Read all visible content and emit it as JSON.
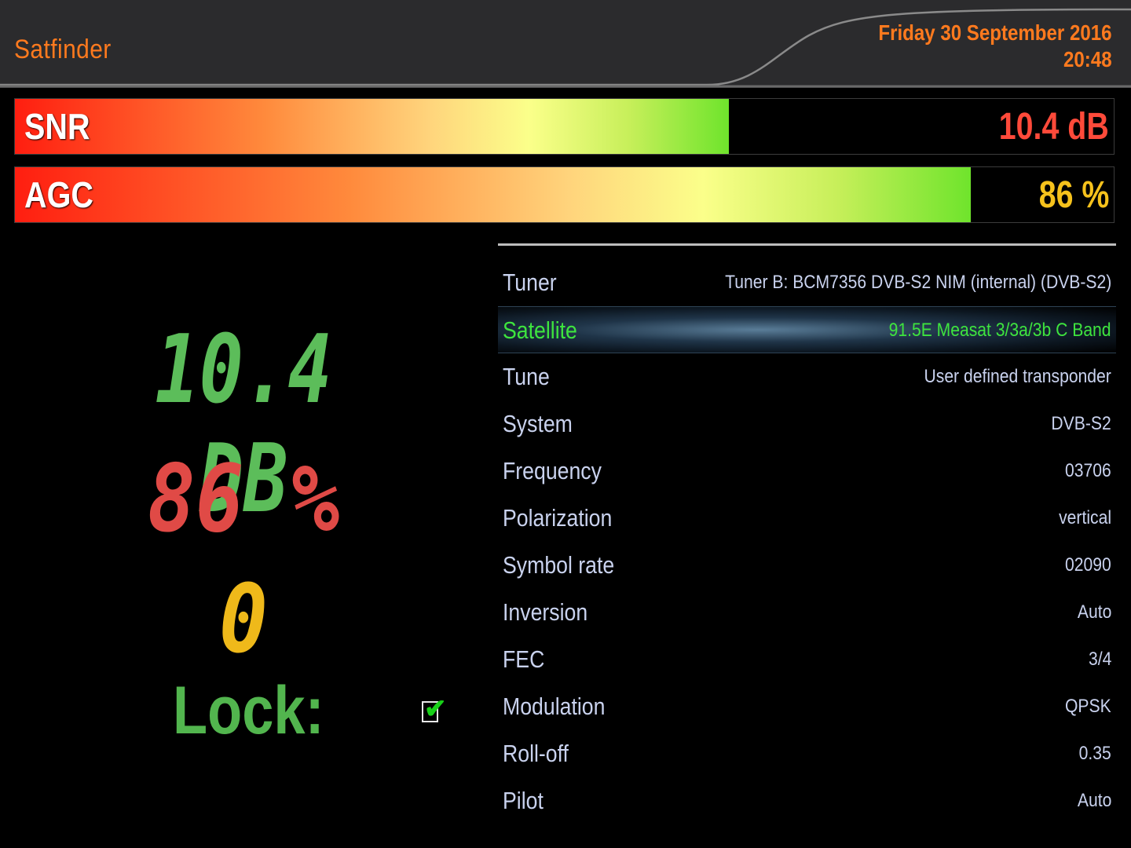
{
  "header": {
    "title": "Satfinder",
    "date": "Friday 30 September 2016",
    "time": "20:48",
    "accent_color": "#ff7a1e"
  },
  "meters": {
    "snr": {
      "label": "SNR",
      "value": "10.4 dB",
      "level": 0.65,
      "value_color": "#ff4a3a"
    },
    "agc": {
      "label": "AGC",
      "value": "86 %",
      "level": 0.87,
      "value_color": "#f6c21c"
    }
  },
  "big_display": {
    "snr": "10.4 DB",
    "agc": "86 %",
    "ber": "0",
    "lock_label": "Lock:",
    "lock_checked": true,
    "check_icon": "checkmark-icon"
  },
  "info": {
    "selected_index": 1,
    "rows": [
      {
        "label": "Tuner",
        "value": "Tuner B: BCM7356 DVB-S2 NIM (internal) (DVB-S2)"
      },
      {
        "label": "Satellite",
        "value": "91.5E Measat 3/3a/3b C Band"
      },
      {
        "label": "Tune",
        "value": "User defined transponder"
      },
      {
        "label": "System",
        "value": "DVB-S2"
      },
      {
        "label": "Frequency",
        "value": "03706"
      },
      {
        "label": "Polarization",
        "value": "vertical"
      },
      {
        "label": "Symbol rate",
        "value": "02090"
      },
      {
        "label": "Inversion",
        "value": "Auto"
      },
      {
        "label": "FEC",
        "value": "3/4"
      },
      {
        "label": "Modulation",
        "value": "QPSK"
      },
      {
        "label": "Roll-off",
        "value": "0.35"
      },
      {
        "label": "Pilot",
        "value": "Auto"
      }
    ]
  }
}
